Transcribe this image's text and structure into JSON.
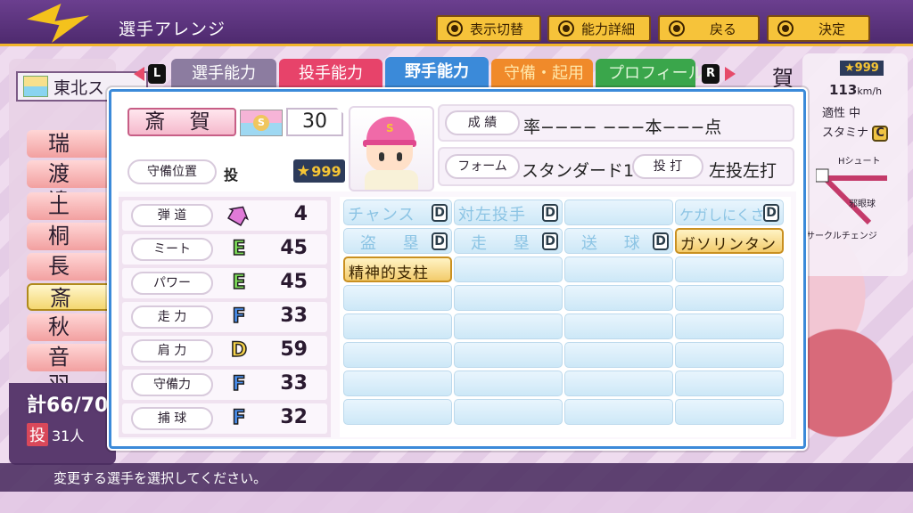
{
  "header": {
    "title": "選手アレンジ",
    "buttons": [
      {
        "label": "表示切替"
      },
      {
        "label": "能力詳細"
      },
      {
        "label": "戻る"
      },
      {
        "label": "決定"
      }
    ]
  },
  "background": {
    "team_name": "東北ス",
    "roster": [
      "瑞 季",
      "渡 邊",
      "土 屋",
      "桐 畑",
      "長 尾",
      "斎 賀",
      "秋 元",
      "音 羽"
    ],
    "total": "計66/70",
    "bat_label": "投",
    "bat_count": "31人",
    "right_panel": {
      "star": "999",
      "speed": "113",
      "speed_unit": "km/h",
      "control_label": "適性 中",
      "stamina_label": "スタミナ",
      "stamina_grade": "C",
      "pitch_1": "Hシュート",
      "pitch_2": "邪眼球",
      "pitch_3": "サークルチェンジ"
    },
    "portrait_name_fragment": "賀"
  },
  "tabs": {
    "left_key": "L",
    "right_key": "R",
    "items": [
      {
        "label": "選手能力"
      },
      {
        "label": "投手能力"
      },
      {
        "label": "野手能力"
      },
      {
        "label": "守備・起用"
      },
      {
        "label": "プロフィール"
      }
    ],
    "active_index": 2
  },
  "player": {
    "name": "斎 賀",
    "number": "30",
    "position_label": "守備位置",
    "position": "投",
    "star_rating": "999",
    "result_label": "成 績",
    "result_value": "率−−−− −−−本−−−点",
    "form_label": "フォーム",
    "form_value": "スタンダード1",
    "throwbat_label": "投 打",
    "throwbat_value": "左投左打"
  },
  "stats": [
    {
      "label": "弾 道",
      "grade": "↑",
      "value": "4",
      "color": "#e07ad8"
    },
    {
      "label": "ミート",
      "grade": "E",
      "value": "45",
      "color": "#7fe05a"
    },
    {
      "label": "パワー",
      "grade": "E",
      "value": "45",
      "color": "#7fe05a"
    },
    {
      "label": "走 力",
      "grade": "F",
      "value": "33",
      "color": "#4a8ff0"
    },
    {
      "label": "肩 力",
      "grade": "D",
      "value": "59",
      "color": "#f6d24a"
    },
    {
      "label": "守備力",
      "grade": "F",
      "value": "33",
      "color": "#4a8ff0"
    },
    {
      "label": "捕 球",
      "grade": "F",
      "value": "32",
      "color": "#4a8ff0"
    }
  ],
  "skills": {
    "chance": {
      "name": "チャンス",
      "grade": "D"
    },
    "vs_left": {
      "name": "対左投手",
      "grade": "D"
    },
    "injury": {
      "name": "ケガしにくさ",
      "grade": "D"
    },
    "steal": {
      "name": "盗 塁",
      "grade": "D"
    },
    "baserun": {
      "name": "走 塁",
      "grade": "D"
    },
    "throw": {
      "name": "送 球",
      "grade": "D"
    },
    "special_1": "ガソリンタンク",
    "special_2": "精神的支柱"
  },
  "help_text": "変更する選手を選択してください。"
}
